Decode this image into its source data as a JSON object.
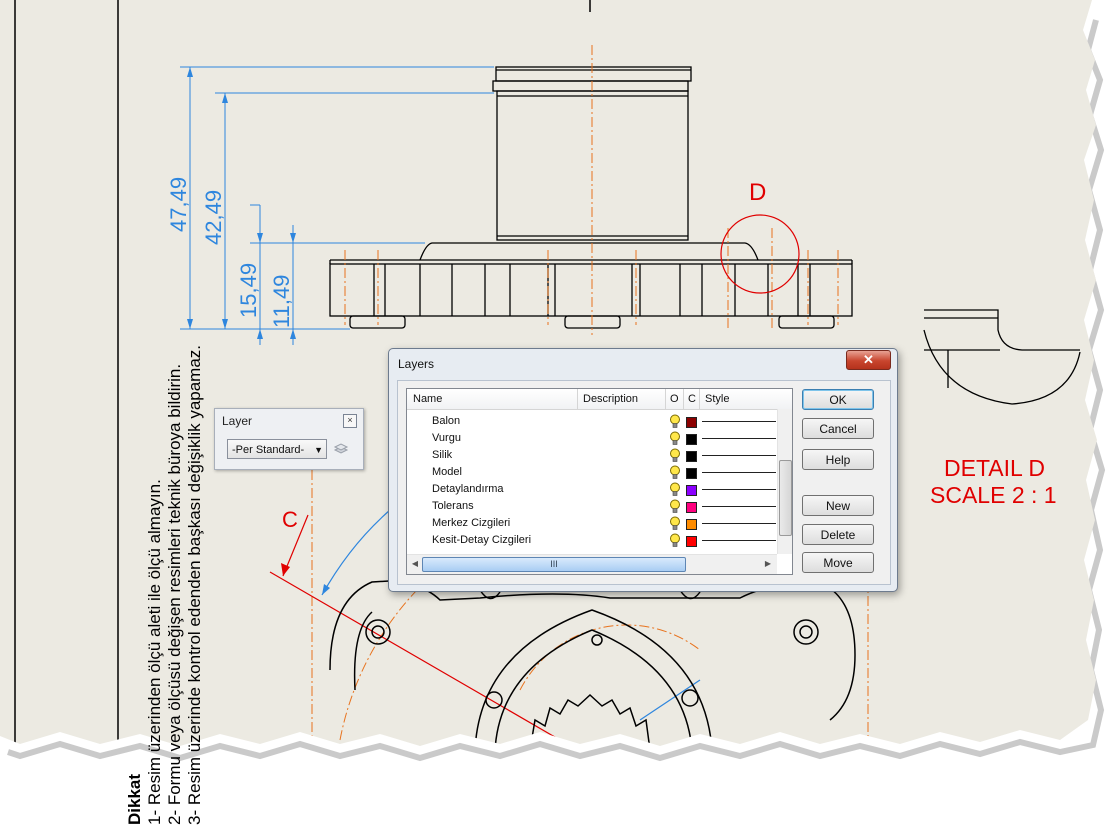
{
  "drawing": {
    "dimensions": [
      "47,49",
      "42,49",
      "15,49",
      "11,49"
    ],
    "balloon_d": "D",
    "section_c": "C",
    "detail_title": "DETAIL D",
    "detail_scale": "SCALE 2 : 1"
  },
  "notes": {
    "heading": "Dikkat",
    "lines": [
      "1- Resim üzerinden ölçü aleti ile ölçü almayın.",
      "2- Formu veya ölçüsü değişen resimleri teknik büroya bildirin.",
      "3- Resim üzerinde kontrol edenden başkası değişiklik yapamaz."
    ]
  },
  "layer_panel": {
    "title": "Layer",
    "selected": "-Per Standard-"
  },
  "layers_dialog": {
    "title": "Layers",
    "columns": {
      "name": "Name",
      "description": "Description",
      "on": "O",
      "color": "C",
      "style": "Style"
    },
    "rows": [
      {
        "name": "Balon",
        "color": "#8b0000"
      },
      {
        "name": "Vurgu",
        "color": "#000000"
      },
      {
        "name": "Silik",
        "color": "#000000"
      },
      {
        "name": "Model",
        "color": "#000000"
      },
      {
        "name": "Detaylandırma",
        "color": "#8b00ff"
      },
      {
        "name": "Tolerans",
        "color": "#ff007f"
      },
      {
        "name": "Merkez Cizgileri",
        "color": "#ff8c00"
      },
      {
        "name": "Kesit-Detay Cizgileri",
        "color": "#ff0000"
      }
    ],
    "buttons": {
      "ok": "OK",
      "cancel": "Cancel",
      "help": "Help",
      "new": "New",
      "delete": "Delete",
      "move": "Move"
    },
    "scroll_thumb_label": "III"
  },
  "colors": {
    "sheet_bg": "#eceae2",
    "dimension_blue": "#2e86de",
    "centerline_orange": "#e8731e",
    "detail_red": "#e00000"
  }
}
